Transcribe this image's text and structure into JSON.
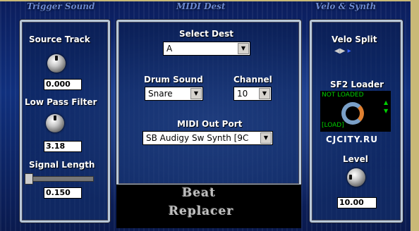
{
  "headers": {
    "trigger": "Trigger Sound",
    "midi": "MIDI Dest",
    "velo": "Velo & Synth"
  },
  "trigger": {
    "source_track_label": "Source Track",
    "source_track_value": "0.000",
    "low_pass_label": "Low Pass Filter",
    "low_pass_value": "3.18",
    "signal_length_label": "Signal Length",
    "signal_length_value": "0.150"
  },
  "midi": {
    "select_dest_label": "Select Dest",
    "select_dest_value": "A",
    "drum_sound_label": "Drum Sound",
    "drum_sound_value": "Snare",
    "channel_label": "Channel",
    "channel_value": "10",
    "out_port_label": "MIDI Out Port",
    "out_port_value": "SB Audigy Sw Synth [9C"
  },
  "velo": {
    "velo_split_label": "Velo Split",
    "sf2_label": "SF2 Loader",
    "sf2_status": "NOT LOADED",
    "sf2_load": "[LOAD]",
    "watermark": "CJCITY.RU",
    "level_label": "Level",
    "level_value": "10.00"
  },
  "logo": {
    "line1": "Beat",
    "line2": "Replacer"
  },
  "colors": {
    "panel_border": "#b9c8d8",
    "frame": "#c9b977",
    "sf2_status_green": "#00d000"
  }
}
